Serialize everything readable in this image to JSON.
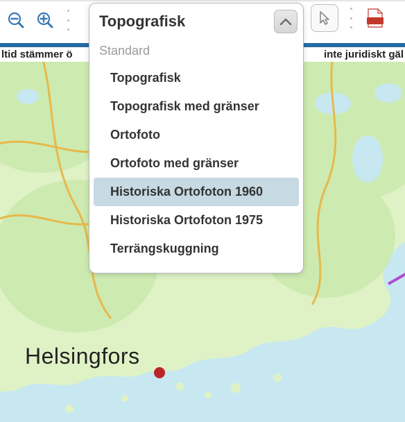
{
  "toolbar": {
    "zoom_out": "zoom-out",
    "zoom_in": "zoom-in",
    "pointer": "pointer",
    "pdf": "pdf"
  },
  "banner": {
    "left_fragment": "ltid stämmer ö",
    "right_fragment": "inte juridiskt gäl"
  },
  "dropdown": {
    "current": "Topografisk",
    "group_label": "Standard",
    "items": [
      "Topografisk",
      "Topografisk med gränser",
      "Ortofoto",
      "Ortofoto med gränser",
      "Historiska Ortofoton 1960",
      "Historiska Ortofoton 1975",
      "Terrängskuggning"
    ],
    "selected_index": 4
  },
  "map": {
    "city_label": "Helsingfors",
    "colors": {
      "land": "#dff2c6",
      "water": "#c7e8f0",
      "forest": "#b9e0a4",
      "road": "#e8b84a",
      "city_dot": "#b8262a"
    }
  }
}
